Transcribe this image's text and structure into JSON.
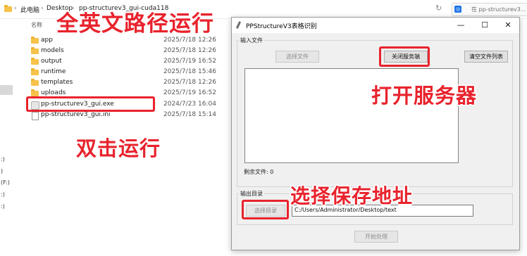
{
  "explorer": {
    "breadcrumb": {
      "root": "此电脑",
      "sep": "›",
      "desktop": "Desktop",
      "folder": "pp-structurev3_gui-cuda118"
    },
    "search_placeholder": "在 pp-structurev3...",
    "column_name": "名称",
    "nav_labels": [
      ":)",
      ")",
      "(F:)",
      ":)",
      ":)"
    ],
    "files": [
      {
        "name": "app",
        "date": "2025/7/18 12:26",
        "type": "folder"
      },
      {
        "name": "models",
        "date": "2025/7/18 12:26",
        "type": "folder"
      },
      {
        "name": "output",
        "date": "2025/7/19 16:52",
        "type": "folder"
      },
      {
        "name": "runtime",
        "date": "2025/7/18 15:46",
        "type": "folder"
      },
      {
        "name": "templates",
        "date": "2025/7/18 12:26",
        "type": "folder"
      },
      {
        "name": "uploads",
        "date": "2025/7/19 16:52",
        "type": "folder"
      },
      {
        "name": "pp-structurev3_gui.exe",
        "date": "2024/7/23 16:04",
        "type": "exe"
      },
      {
        "name": "pp-structurev3_gui.ini",
        "date": "2025/7/18 15:14",
        "type": "ini"
      }
    ]
  },
  "annotations": {
    "all_english_path": "全英文路径运行",
    "double_click_run": "双击运行",
    "open_server": "打开服务器",
    "choose_save_location": "选择保存地址",
    "color": "#e8232d"
  },
  "app_window": {
    "title": "PPStructureV3表格识别",
    "controls": {
      "minimize": "—",
      "maximize": "☐",
      "close": "✕"
    },
    "input_group_label": "输入文件",
    "select_file_button": "选择文件",
    "close_server_button": "关闭服务端",
    "clear_list_button": "清空文件列表",
    "remaining_files": "剩余文件: 0",
    "output_group_label": "输出目录",
    "select_dir_button": "选择目录",
    "output_path": "C:/Users/Administrator/Desktop/text",
    "start_button": "开始处理"
  }
}
